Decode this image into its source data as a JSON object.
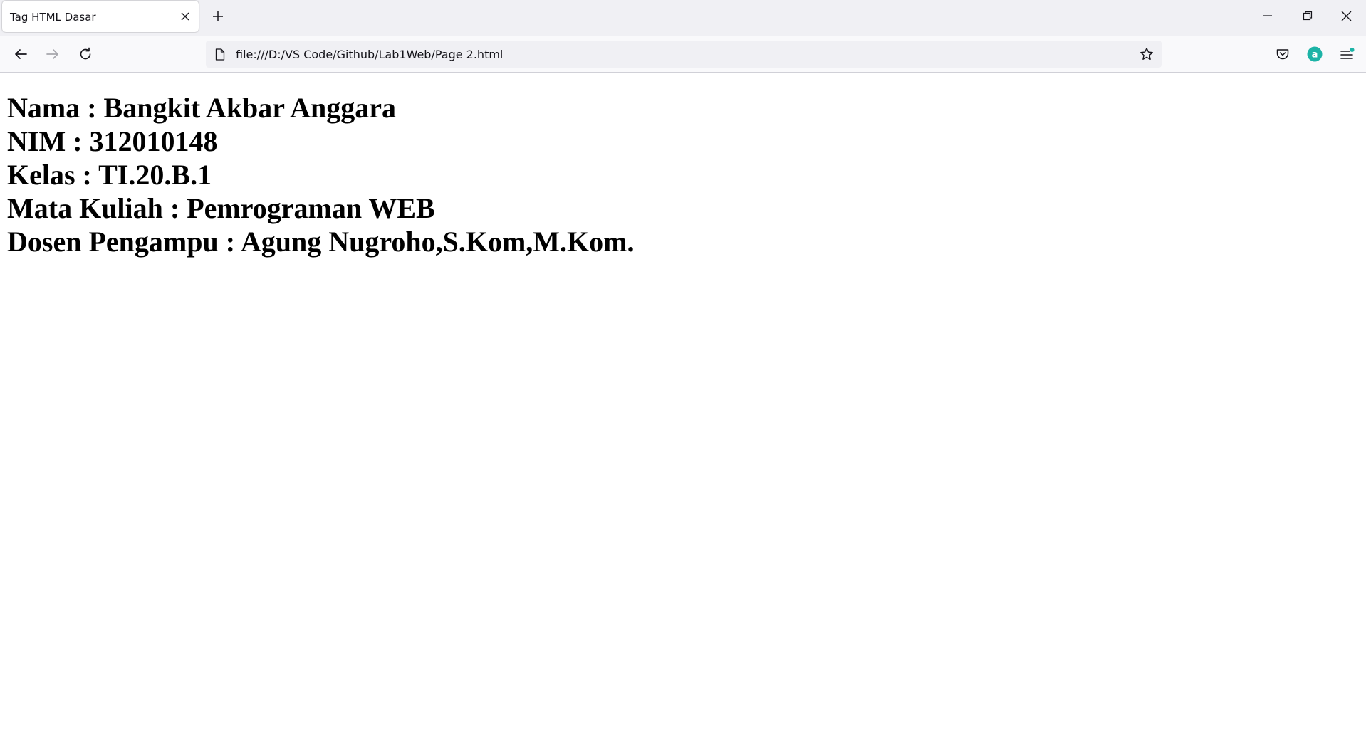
{
  "browser": {
    "tab": {
      "title": "Tag HTML Dasar",
      "close_icon": "close-icon"
    },
    "new_tab_icon": "plus-icon",
    "window_controls": [
      "minimize-icon",
      "restore-icon",
      "close-icon"
    ],
    "nav": {
      "back_icon": "arrow-left-icon",
      "forward_icon": "arrow-right-icon",
      "reload_icon": "reload-icon"
    },
    "url": "file:///D:/VS Code/Github/Lab1Web/Page 2.html",
    "toolbar_icons": [
      "pocket-icon",
      "account-icon",
      "menu-icon"
    ],
    "account_badge": "a",
    "accent_color": "#1cb3a6"
  },
  "page": {
    "lines": [
      "Nama : Bangkit Akbar Anggara",
      "NIM : 312010148",
      "Kelas : TI.20.B.1",
      "Mata Kuliah : Pemrograman WEB",
      "Dosen Pengampu : Agung Nugroho,S.Kom,M.Kom."
    ]
  }
}
